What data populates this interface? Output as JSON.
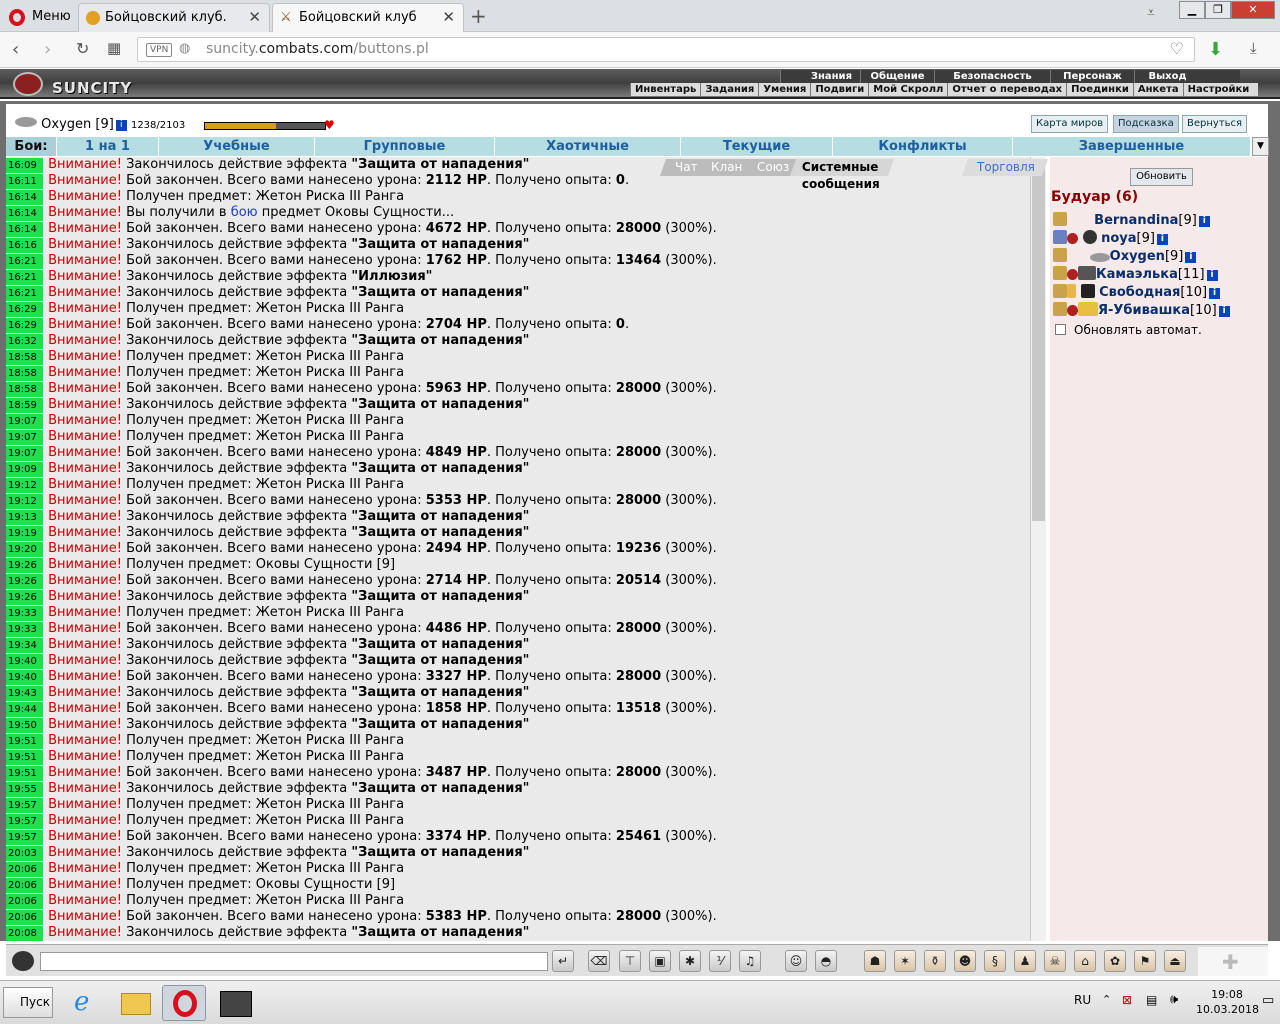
{
  "browser": {
    "menu_label": "Меню",
    "tabs": [
      {
        "title": "Бойцовский клуб."
      },
      {
        "title": "Бойцовский клуб"
      }
    ],
    "new_tab": "+",
    "url_prefix": "suncity.",
    "url_domain": "combats.com",
    "url_path": "/buttons.pl",
    "vpn": "VPN"
  },
  "game": {
    "logo": "SUNCITY",
    "top_menu": [
      "Знания",
      "Общение",
      "Безопасность",
      "Персонаж",
      "Выход"
    ],
    "sub_menu": [
      "Инвентарь",
      "Задания",
      "Умения",
      "Подвиги",
      "Мой Скролл",
      "Отчет о переводах",
      "Поединки",
      "Анкета",
      "Настройки"
    ],
    "character": {
      "name": "Oxygen",
      "level": "[9]",
      "hp": "1238/2103",
      "hp_fraction": 0.59
    },
    "map_buttons": [
      "Карта миров",
      "Подсказка",
      "Вернуться"
    ],
    "battle_label": "Бои:",
    "battle_tabs": [
      "1 на 1",
      "Учебные",
      "Групповые",
      "Хаотичные",
      "Текущие",
      "Конфликты",
      "Завершенные"
    ],
    "chat_tabs": [
      "Чат",
      "Клан",
      "Союз",
      "Системные сообщения",
      "Торговля"
    ],
    "refresh": "Обновить",
    "room_title": "Будуар (6)",
    "players": [
      {
        "name": "Bernandina",
        "level": "[9]"
      },
      {
        "name": "noya",
        "level": "[9]"
      },
      {
        "name": "Oxygen",
        "level": "[9]"
      },
      {
        "name": "Камаэлька",
        "level": "[11]"
      },
      {
        "name": "Свободная",
        "level": "[10]"
      },
      {
        "name": "Я-Убивашка",
        "level": "[10]"
      }
    ],
    "auto_refresh": "Обновлять автомат.",
    "warning": "Внимание!",
    "messages": [
      {
        "time": "16:09",
        "text": "Закончилось действие эффекта ",
        "bold": "\"Защита от нападения\""
      },
      {
        "time": "16:11",
        "text": "Бой закончен. Всего вами нанесено урона: ",
        "dmg": "2112 HP",
        "mid": ". Получено опыта: ",
        "exp": "0",
        "tail": "."
      },
      {
        "time": "16:14",
        "text": "Получен предмет: Жетон Риска III Ранга"
      },
      {
        "time": "16:14",
        "text": "Вы получили в ",
        "link": "бою",
        "tail": " предмет Оковы Сущности..."
      },
      {
        "time": "16:14",
        "text": "Бой закончен. Всего вами нанесено урона: ",
        "dmg": "4672 HP",
        "mid": ". Получено опыта: ",
        "exp": "28000",
        "tail": " (300%)."
      },
      {
        "time": "16:16",
        "text": "Закончилось действие эффекта ",
        "bold": "\"Защита от нападения\""
      },
      {
        "time": "16:21",
        "text": "Бой закончен. Всего вами нанесено урона: ",
        "dmg": "1762 HP",
        "mid": ". Получено опыта: ",
        "exp": "13464",
        "tail": " (300%)."
      },
      {
        "time": "16:21",
        "text": "Закончилось действие эффекта ",
        "bold": "\"Иллюзия\""
      },
      {
        "time": "16:21",
        "text": "Закончилось действие эффекта ",
        "bold": "\"Защита от нападения\""
      },
      {
        "time": "16:29",
        "text": "Получен предмет: Жетон Риска III Ранга"
      },
      {
        "time": "16:29",
        "text": "Бой закончен. Всего вами нанесено урона: ",
        "dmg": "2704 HP",
        "mid": ". Получено опыта: ",
        "exp": "0",
        "tail": "."
      },
      {
        "time": "16:32",
        "text": "Закончилось действие эффекта ",
        "bold": "\"Защита от нападения\""
      },
      {
        "time": "18:58",
        "text": "Получен предмет: Жетон Риска III Ранга"
      },
      {
        "time": "18:58",
        "text": "Получен предмет: Жетон Риска III Ранга"
      },
      {
        "time": "18:58",
        "text": "Бой закончен. Всего вами нанесено урона: ",
        "dmg": "5963 HP",
        "mid": ". Получено опыта: ",
        "exp": "28000",
        "tail": " (300%)."
      },
      {
        "time": "18:59",
        "text": "Закончилось действие эффекта ",
        "bold": "\"Защита от нападения\""
      },
      {
        "time": "19:07",
        "text": "Получен предмет: Жетон Риска III Ранга"
      },
      {
        "time": "19:07",
        "text": "Получен предмет: Жетон Риска III Ранга"
      },
      {
        "time": "19:07",
        "text": "Бой закончен. Всего вами нанесено урона: ",
        "dmg": "4849 HP",
        "mid": ". Получено опыта: ",
        "exp": "28000",
        "tail": " (300%)."
      },
      {
        "time": "19:09",
        "text": "Закончилось действие эффекта ",
        "bold": "\"Защита от нападения\""
      },
      {
        "time": "19:12",
        "text": "Получен предмет: Жетон Риска III Ранга"
      },
      {
        "time": "19:12",
        "text": "Бой закончен. Всего вами нанесено урона: ",
        "dmg": "5353 HP",
        "mid": ". Получено опыта: ",
        "exp": "28000",
        "tail": " (300%)."
      },
      {
        "time": "19:13",
        "text": "Закончилось действие эффекта ",
        "bold": "\"Защита от нападения\""
      },
      {
        "time": "19:19",
        "text": "Закончилось действие эффекта ",
        "bold": "\"Защита от нападения\""
      },
      {
        "time": "19:20",
        "text": "Бой закончен. Всего вами нанесено урона: ",
        "dmg": "2494 HP",
        "mid": ". Получено опыта: ",
        "exp": "19236",
        "tail": " (300%)."
      },
      {
        "time": "19:26",
        "text": "Получен предмет: Оковы Сущности [9]"
      },
      {
        "time": "19:26",
        "text": "Бой закончен. Всего вами нанесено урона: ",
        "dmg": "2714 HP",
        "mid": ". Получено опыта: ",
        "exp": "20514",
        "tail": " (300%)."
      },
      {
        "time": "19:26",
        "text": "Закончилось действие эффекта ",
        "bold": "\"Защита от нападения\""
      },
      {
        "time": "19:33",
        "text": "Получен предмет: Жетон Риска III Ранга"
      },
      {
        "time": "19:33",
        "text": "Бой закончен. Всего вами нанесено урона: ",
        "dmg": "4486 HP",
        "mid": ". Получено опыта: ",
        "exp": "28000",
        "tail": " (300%)."
      },
      {
        "time": "19:34",
        "text": "Закончилось действие эффекта ",
        "bold": "\"Защита от нападения\""
      },
      {
        "time": "19:40",
        "text": "Закончилось действие эффекта ",
        "bold": "\"Защита от нападения\""
      },
      {
        "time": "19:40",
        "text": "Бой закончен. Всего вами нанесено урона: ",
        "dmg": "3327 HP",
        "mid": ". Получено опыта: ",
        "exp": "28000",
        "tail": " (300%)."
      },
      {
        "time": "19:43",
        "text": "Закончилось действие эффекта ",
        "bold": "\"Защита от нападения\""
      },
      {
        "time": "19:44",
        "text": "Бой закончен. Всего вами нанесено урона: ",
        "dmg": "1858 HP",
        "mid": ". Получено опыта: ",
        "exp": "13518",
        "tail": " (300%)."
      },
      {
        "time": "19:50",
        "text": "Закончилось действие эффекта ",
        "bold": "\"Защита от нападения\""
      },
      {
        "time": "19:51",
        "text": "Получен предмет: Жетон Риска III Ранга"
      },
      {
        "time": "19:51",
        "text": "Получен предмет: Жетон Риска III Ранга"
      },
      {
        "time": "19:51",
        "text": "Бой закончен. Всего вами нанесено урона: ",
        "dmg": "3487 HP",
        "mid": ". Получено опыта: ",
        "exp": "28000",
        "tail": " (300%)."
      },
      {
        "time": "19:55",
        "text": "Закончилось действие эффекта ",
        "bold": "\"Защита от нападения\""
      },
      {
        "time": "19:57",
        "text": "Получен предмет: Жетон Риска III Ранга"
      },
      {
        "time": "19:57",
        "text": "Получен предмет: Жетон Риска III Ранга"
      },
      {
        "time": "19:57",
        "text": "Бой закончен. Всего вами нанесено урона: ",
        "dmg": "3374 HP",
        "mid": ". Получено опыта: ",
        "exp": "25461",
        "tail": " (300%)."
      },
      {
        "time": "20:03",
        "text": "Закончилось действие эффекта ",
        "bold": "\"Защита от нападения\""
      },
      {
        "time": "20:06",
        "text": "Получен предмет: Жетон Риска III Ранга"
      },
      {
        "time": "20:06",
        "text": "Получен предмет: Оковы Сущности [9]"
      },
      {
        "time": "20:06",
        "text": "Получен предмет: Жетон Риска III Ранга"
      },
      {
        "time": "20:06",
        "text": "Бой закончен. Всего вами нанесено урона: ",
        "dmg": "5383 HP",
        "mid": ". Получено опыта: ",
        "exp": "28000",
        "tail": " (300%)."
      },
      {
        "time": "20:08",
        "text": "Закончилось действие эффекта ",
        "bold": "\"Защита от нападения\""
      }
    ]
  },
  "taskbar": {
    "start": "Пуск",
    "lang": "RU",
    "time": "19:08",
    "date": "10.03.2018"
  }
}
